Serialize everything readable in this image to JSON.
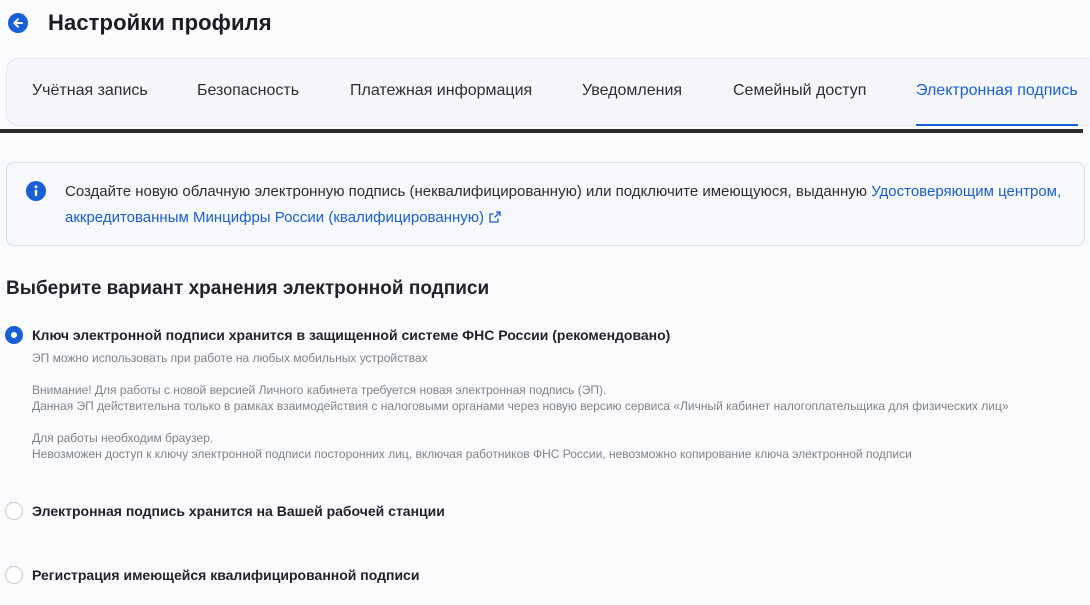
{
  "header": {
    "title": "Настройки профиля",
    "back_icon": "arrow-left-icon"
  },
  "tabs": [
    {
      "label": "Учётная запись",
      "active": false
    },
    {
      "label": "Безопасность",
      "active": false
    },
    {
      "label": "Платежная информация",
      "active": false
    },
    {
      "label": "Уведомления",
      "active": false
    },
    {
      "label": "Семейный доступ",
      "active": false
    },
    {
      "label": "Электронная подпись",
      "active": true
    }
  ],
  "info": {
    "text": "Создайте новую облачную электронную подпись (неквалифицированную) или подключите имеющуюся, выданную ",
    "link": "Удостоверяющим центром, аккредитованным Минцифры России (квалифицированную)",
    "icon": "info-icon",
    "link_icon": "external-link-icon"
  },
  "section_title": "Выберите вариант хранения электронной подписи",
  "options": [
    {
      "label": "Ключ электронной подписи хранится в защищенной системе ФНС России (рекомендовано)",
      "checked": true,
      "descriptions": [
        "ЭП можно использовать при работе на любых мобильных устройствах",
        "Внимание! Для работы с новой версией Личного кабинета требуется новая электронная подпись (ЭП).",
        "Данная ЭП действительна только в рамках взаимодействия с налоговыми органами через новую версию сервиса «Личный кабинет налогоплательщика для физических лиц»",
        "Для работы необходим браузер.",
        "Невозможен доступ к ключу электронной подписи посторонних лиц, включая работников ФНС России, невозможно копирование ключа электронной подписи"
      ]
    },
    {
      "label": "Электронная подпись хранится на Вашей рабочей станции",
      "checked": false
    },
    {
      "label": "Регистрация имеющейся квалифицированной подписи",
      "checked": false
    }
  ],
  "colors": {
    "accent": "#1a5fd7",
    "text": "#1f2226",
    "muted": "#7d838b",
    "info_border": "#cfe0e6"
  }
}
